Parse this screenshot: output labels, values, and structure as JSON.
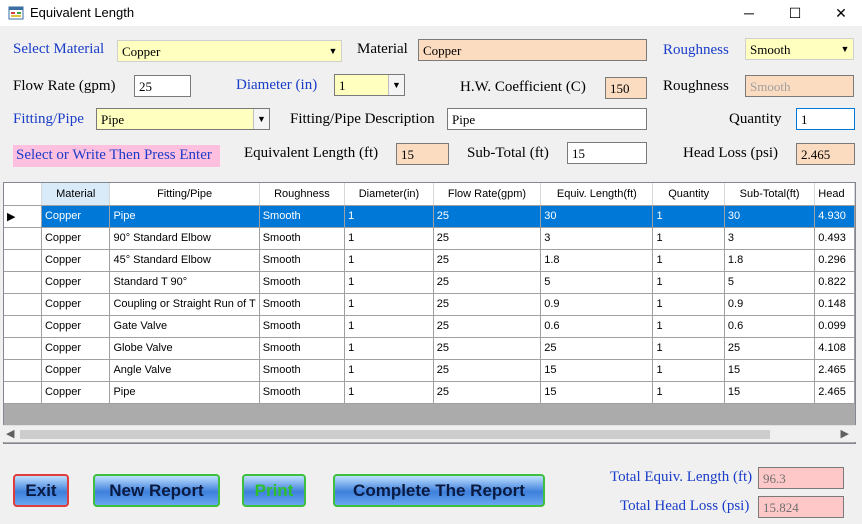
{
  "window": {
    "title": "Equivalent Length",
    "minimize_glyph": "─",
    "maximize_glyph": "☐",
    "close_glyph": "✕"
  },
  "form": {
    "select_material_label": "Select Material",
    "select_material_value": "Copper",
    "material_label": "Material",
    "material_value": "Copper",
    "roughness_select_label": "Roughness",
    "roughness_select_value": "Smooth",
    "flow_rate_label": "Flow Rate (gpm)",
    "flow_rate_value": "25",
    "diameter_label": "Diameter (in)",
    "diameter_value": "1",
    "hw_coefficient_label": "H.W. Coefficient (C)",
    "hw_coefficient_value": "150",
    "roughness_label": "Roughness",
    "roughness_value": "Smooth",
    "fitting_pipe_label": "Fitting/Pipe",
    "fitting_pipe_value": "Pipe",
    "fitting_description_label": "Fitting/Pipe Description",
    "fitting_description_value": "Pipe",
    "quantity_label": "Quantity",
    "quantity_value": "1",
    "hint_text": "Select or Write Then Press Enter",
    "equivalent_length_label": "Equivalent Length (ft)",
    "equivalent_length_value": "15",
    "subtotal_label": "Sub-Total (ft)",
    "subtotal_value": "15",
    "head_loss_label": "Head Loss (psi)",
    "head_loss_value": "2.465"
  },
  "grid": {
    "columns": [
      "Material",
      "Fitting/Pipe",
      "Roughness",
      "Diameter(in)",
      "Flow Rate(gpm)",
      "Equiv. Length(ft)",
      "Quantity",
      "Sub-Total(ft)",
      "Head"
    ],
    "rows": [
      [
        "Copper",
        "Pipe",
        "Smooth",
        "1",
        "25",
        "30",
        "1",
        "30",
        "4.930"
      ],
      [
        "Copper",
        "90° Standard Elbow",
        "Smooth",
        "1",
        "25",
        "3",
        "1",
        "3",
        "0.493"
      ],
      [
        "Copper",
        "45° Standard Elbow",
        "Smooth",
        "1",
        "25",
        "1.8",
        "1",
        "1.8",
        "0.296"
      ],
      [
        "Copper",
        "Standard T 90°",
        "Smooth",
        "1",
        "25",
        "5",
        "1",
        "5",
        "0.822"
      ],
      [
        "Copper",
        "Coupling or Straight Run of T",
        "Smooth",
        "1",
        "25",
        "0.9",
        "1",
        "0.9",
        "0.148"
      ],
      [
        "Copper",
        "Gate Valve",
        "Smooth",
        "1",
        "25",
        "0.6",
        "1",
        "0.6",
        "0.099"
      ],
      [
        "Copper",
        "Globe Valve",
        "Smooth",
        "1",
        "25",
        "25",
        "1",
        "25",
        "4.108"
      ],
      [
        "Copper",
        "Angle Valve",
        "Smooth",
        "1",
        "25",
        "15",
        "1",
        "15",
        "2.465"
      ],
      [
        "Copper",
        "Pipe",
        "Smooth",
        "1",
        "25",
        "15",
        "1",
        "15",
        "2.465"
      ]
    ],
    "selected_row_indicator": "▶"
  },
  "buttons": {
    "exit": "Exit",
    "new_report": "New Report",
    "print": "Print",
    "complete_report": "Complete The Report"
  },
  "totals": {
    "total_equiv_length_label": "Total Equiv. Length (ft)",
    "total_equiv_length_value": "96.3",
    "total_head_loss_label": "Total Head Loss (psi)",
    "total_head_loss_value": "15.824"
  },
  "icons": {
    "app": "app-form-icon",
    "dropdown": "chevron-down-icon"
  },
  "colors": {
    "blue_label": "#1a3cc8",
    "selection": "#0078d7",
    "yellow_field": "#ffffc0",
    "peach_field": "#fcdcc0",
    "hint_bg": "#ffc0e0"
  }
}
